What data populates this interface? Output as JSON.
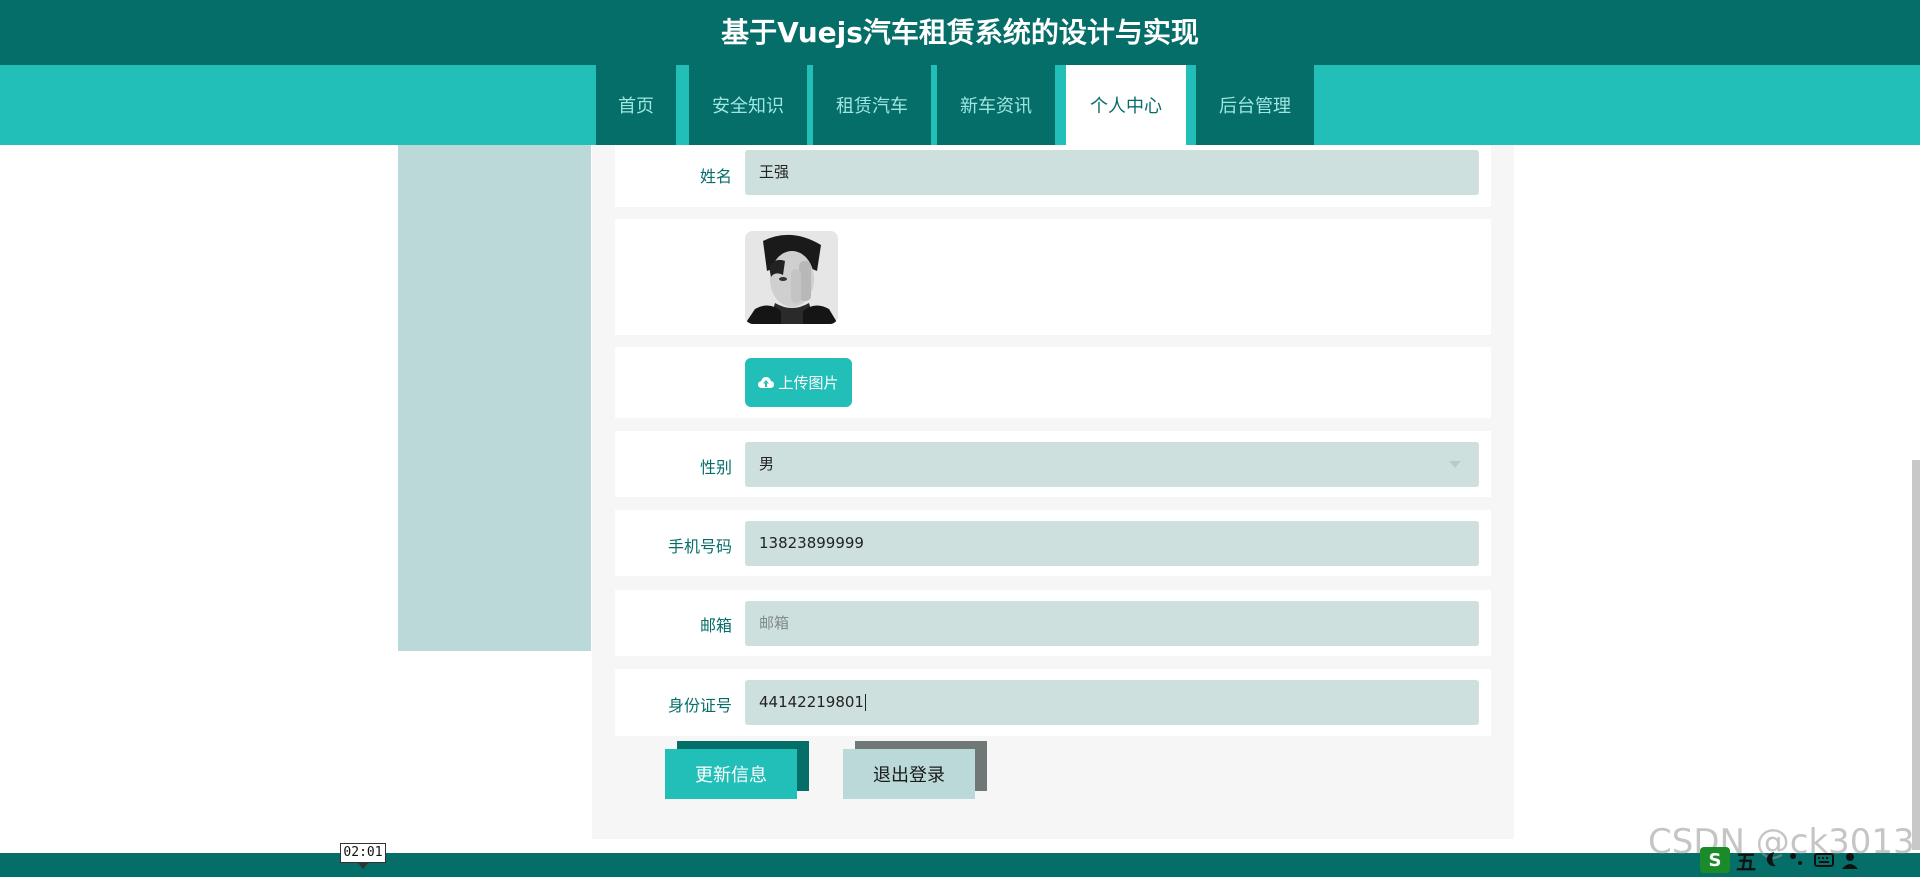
{
  "app": {
    "title": "基于Vuejs汽车租赁系统的设计与实现"
  },
  "nav": {
    "items": [
      {
        "label": "首页",
        "active": false
      },
      {
        "label": "安全知识",
        "active": false
      },
      {
        "label": "租赁汽车",
        "active": false
      },
      {
        "label": "新车资讯",
        "active": false
      },
      {
        "label": "个人中心",
        "active": true
      },
      {
        "label": "后台管理",
        "active": false
      }
    ]
  },
  "form": {
    "name": {
      "label": "姓名",
      "value": "王强"
    },
    "avatar": {
      "icon": "portrait-photo"
    },
    "upload": {
      "label": "上传图片",
      "icon": "cloud-upload-icon"
    },
    "gender": {
      "label": "性别",
      "value": "男",
      "icon": "chevron-down-icon"
    },
    "phone": {
      "label": "手机号码",
      "value": "13823899999"
    },
    "email": {
      "label": "邮箱",
      "value": "",
      "placeholder": "邮箱"
    },
    "idcard": {
      "label": "身份证号",
      "value": "44142219801"
    }
  },
  "actions": {
    "update_label": "更新信息",
    "logout_label": "退出登录"
  },
  "overlay": {
    "time_badge": "02:01",
    "watermark": "CSDN @ck3013",
    "tray_ime": "五"
  },
  "colors": {
    "primary_dark": "#056e69",
    "primary": "#21bfb7",
    "field_bg": "#cde0de",
    "sidebar_bg": "#bcd9d9"
  }
}
